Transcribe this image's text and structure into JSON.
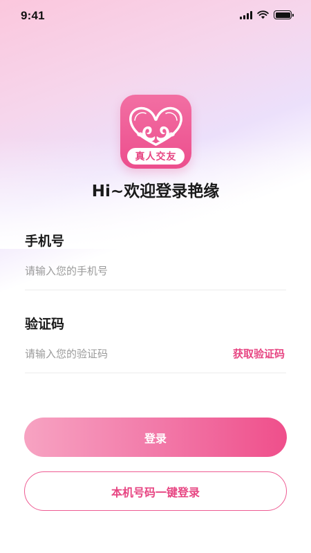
{
  "status_bar": {
    "time": "9:41",
    "battery_level": 1.0
  },
  "logo": {
    "icon": "swan-heart-logo",
    "badge_text": "真人交友"
  },
  "welcome": {
    "title": "Hi~欢迎登录艳缘"
  },
  "phone": {
    "label": "手机号",
    "placeholder": "请输入您的手机号",
    "value": ""
  },
  "code": {
    "label": "验证码",
    "placeholder": "请输入您的验证码",
    "value": "",
    "get_code_label": "获取验证码"
  },
  "buttons": {
    "login_label": "登录",
    "one_click_label": "本机号码一键登录"
  },
  "colors": {
    "accent": "#e74582",
    "logo_pink": "#ec4e8d",
    "button_gradient_start": "#f7a3c2",
    "button_gradient_end": "#ef4f8b"
  }
}
